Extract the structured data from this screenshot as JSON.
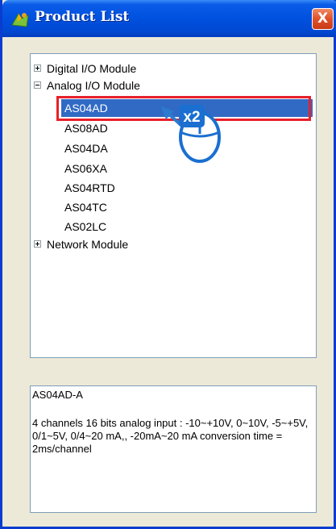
{
  "window": {
    "title": "Product List",
    "close_label": "X"
  },
  "tree": {
    "nodes": [
      {
        "label": "Digital I/O Module",
        "expander": "plus"
      },
      {
        "label": "Analog I/O Module",
        "expander": "minus"
      },
      {
        "label": "AS04AD",
        "selected": true
      },
      {
        "label": "AS08AD"
      },
      {
        "label": "AS04DA"
      },
      {
        "label": "AS06XA"
      },
      {
        "label": "AS04RTD"
      },
      {
        "label": "AS04TC"
      },
      {
        "label": "AS02LC"
      },
      {
        "label": "Network Module",
        "expander": "plus"
      }
    ]
  },
  "description": {
    "name": "AS04AD-A",
    "text": "4 channels 16 bits analog input : -10~+10V, 0~10V, -5~+5V, 0/1~5V, 0/4~20 mA,, -20mA~20 mA conversion time = 2ms/channel"
  },
  "annotation": {
    "click_count": "x2",
    "icon": "mouse-double-click-icon",
    "highlight_color": "#e8202a"
  },
  "colors": {
    "selection": "#316ac5",
    "titlebar": "#0052e0"
  }
}
